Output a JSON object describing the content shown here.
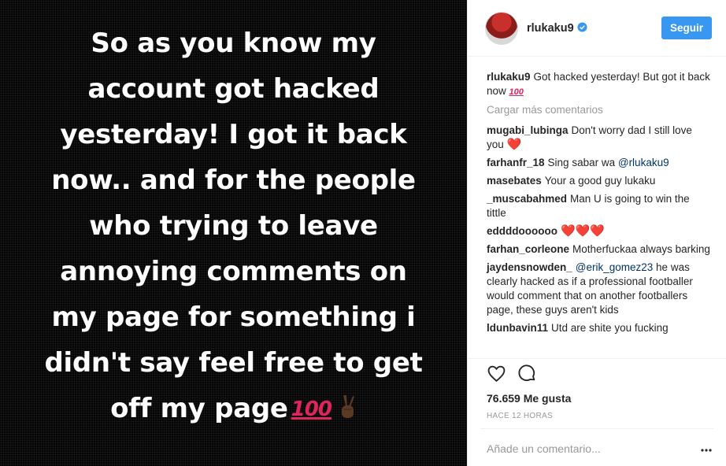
{
  "post": {
    "story_lines": [
      "So as you know my",
      "account got hacked",
      "yesterday! I got it back",
      "now.. and for the people",
      "who trying to leave",
      "annoying comments on",
      "my page for something i",
      "didn't say feel free to get",
      "off my page"
    ],
    "emoji_100": "100",
    "emoji_peace": "peace-hand-emoji"
  },
  "header": {
    "username": "rlukaku9",
    "follow_label": "Seguir",
    "verified_icon": "verified-badge-icon",
    "accent": "#3897f0"
  },
  "caption": {
    "user": "rlukaku9",
    "text": "Got hacked yesterday! But got it back now",
    "emoji": "100"
  },
  "load_more": "Cargar más comentarios",
  "comments": [
    {
      "user": "mugabi_lubinga",
      "text": "Don't worry dad I still love you",
      "emoji": "❤️"
    },
    {
      "user": "farhanfr_18",
      "text": "Sing sabar wa ",
      "mention": "@rlukaku9"
    },
    {
      "user": "masebates",
      "text": "Your a good guy lukaku"
    },
    {
      "user": "_muscabahmed",
      "text": "Man U is going to win the tittle"
    },
    {
      "user": "eddddoooooo",
      "text": "",
      "emoji": "❤️❤️❤️"
    },
    {
      "user": "farhan_corleone",
      "text": "Motherfuckaa always barking"
    },
    {
      "user": "jaydensnowden_",
      "mention_first": "@erik_gomez23",
      "text": " he was clearly hacked as if a professional footballer would comment that on another footballers page, these guys aren't kids"
    },
    {
      "user": "ldunbavin11",
      "text": "Utd are shite you fucking"
    }
  ],
  "likes": "76.659 Me gusta",
  "timestamp": "HACE 12 HORAS",
  "add_comment_placeholder": "Añade un comentario...",
  "icons": {
    "like": "heart-outline-icon",
    "comment": "speech-bubble-icon",
    "more": "more-options-icon"
  }
}
